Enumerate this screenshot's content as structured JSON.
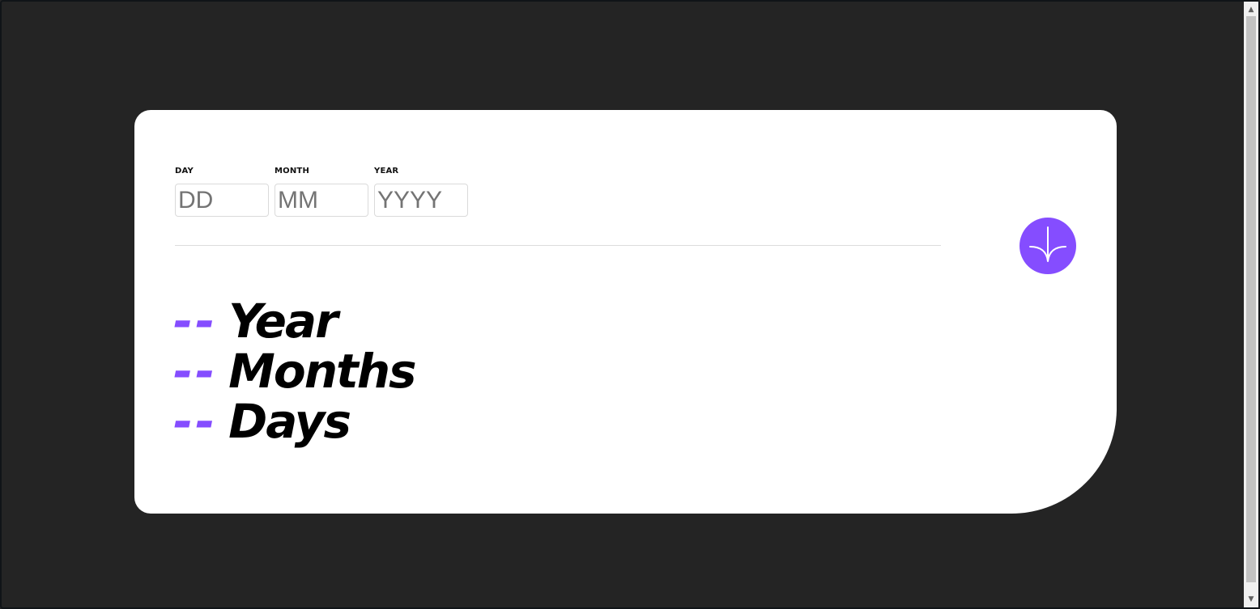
{
  "form": {
    "day": {
      "label": "DAY",
      "placeholder": "DD",
      "value": ""
    },
    "month": {
      "label": "MONTH",
      "placeholder": "MM",
      "value": ""
    },
    "year": {
      "label": "YEAR",
      "placeholder": "YYYY",
      "value": ""
    }
  },
  "submit": {
    "icon": "arrow-down-icon"
  },
  "results": [
    {
      "value": "--",
      "unit": "Year"
    },
    {
      "value": "--",
      "unit": "Months"
    },
    {
      "value": "--",
      "unit": "Days"
    }
  ],
  "colors": {
    "background": "#242424",
    "card": "#ffffff",
    "accent": "#854dff",
    "text": "#000000"
  }
}
